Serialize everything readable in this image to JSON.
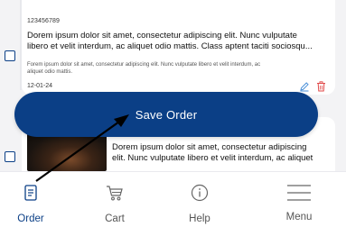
{
  "order_card_top": {
    "order_id": "123456789",
    "title_lines": [
      "Dorem ipsum dolor sit amet, consectetur adipiscing elit. Nunc vulputate",
      "libero et velit interdum, ac aliquet odio mattis. Class aptent taciti sociosqu..."
    ],
    "description_lines": [
      "Forem ipsum dolor sit amet, consectetur adipiscing elit. Nunc vulputate libero et velit interdum, ac",
      "aliquet odio mattis."
    ],
    "date": "12-01-24",
    "icons": {
      "edit": "pencil-icon",
      "delete": "trash-icon"
    }
  },
  "save_button": {
    "label": "Save Order"
  },
  "order_card_bottom": {
    "title_lines": [
      "Dorem ipsum dolor sit amet, consectetur adipiscing",
      "elit. Nunc vulputate libero et velit interdum, ac aliquet"
    ]
  },
  "bottom_nav": {
    "items": [
      {
        "label": "Order",
        "icon": "document-icon",
        "active": true
      },
      {
        "label": "Cart",
        "icon": "cart-icon",
        "active": false
      },
      {
        "label": "Help",
        "icon": "info-icon",
        "active": false
      },
      {
        "label": "Menu",
        "icon": "hamburger-icon",
        "active": false
      }
    ]
  },
  "colors": {
    "primary": "#0b3f86",
    "background": "#f3f3f5",
    "edit_icon": "#4a8fd8",
    "delete_icon": "#e04848"
  }
}
